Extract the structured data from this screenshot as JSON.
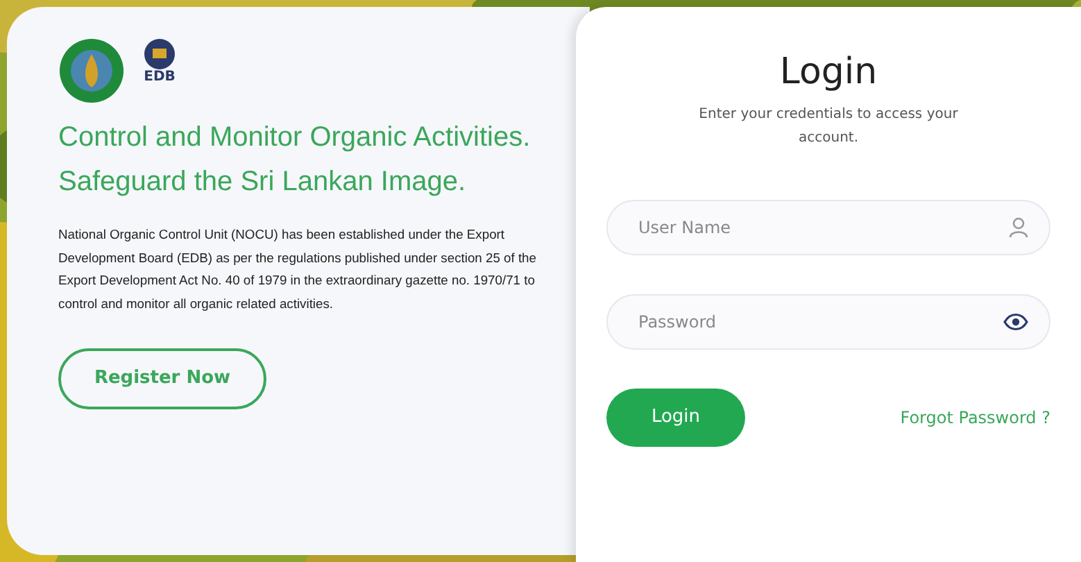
{
  "brand": {
    "logo_text": "EDB"
  },
  "intro": {
    "heading": "Control and Monitor Organic Activities. Safeguard the Sri Lankan Image.",
    "body": "National Organic Control Unit (NOCU) has been established under the Export Development Board (EDB) as per the regulations published under section 25 of the Export Development Act No. 40 of 1979 in the extraordinary gazette no. 1970/71 to control and monitor all organic related activities.",
    "button": "Register Now"
  },
  "login": {
    "title": "Login",
    "subtitle": "Enter your credentials to access your account.",
    "fields": [
      {
        "kind": "user",
        "placeholder": "User Name"
      },
      {
        "kind": "password",
        "placeholder": "Password"
      }
    ],
    "button": "Login",
    "forgot": "Forgot Password ?"
  }
}
